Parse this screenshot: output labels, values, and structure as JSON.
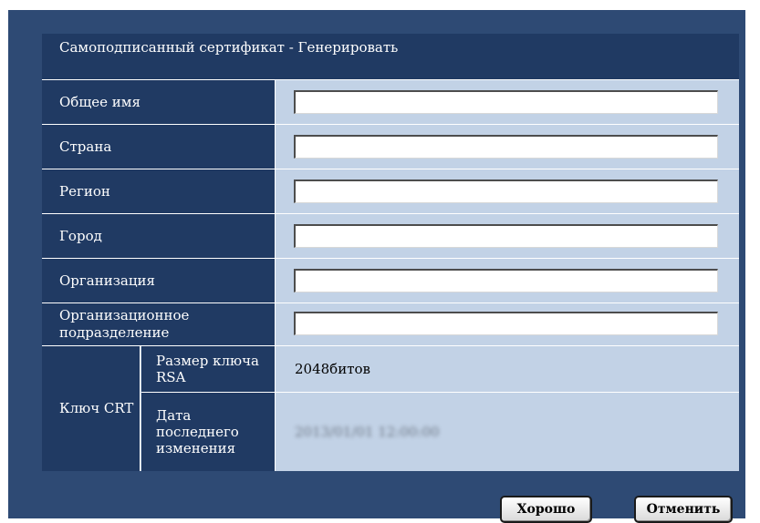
{
  "form": {
    "title": "Самоподписанный сертификат - Генерировать",
    "fields": [
      {
        "label": "Общее имя",
        "value": ""
      },
      {
        "label": "Страна",
        "value": ""
      },
      {
        "label": "Регион",
        "value": ""
      },
      {
        "label": "Город",
        "value": ""
      },
      {
        "label": "Организация",
        "value": ""
      },
      {
        "label": "Организационное подразделение",
        "value": ""
      }
    ],
    "key": {
      "label": "Ключ CRT",
      "rsa_size_label": "Размер ключа RSA",
      "rsa_size_value": "2048битов",
      "last_modified_label": "Дата последнего изменения",
      "last_modified_value": "2013/01/01 12:00:00"
    }
  },
  "buttons": {
    "ok": "Хорошо",
    "cancel": "Отменить"
  }
}
